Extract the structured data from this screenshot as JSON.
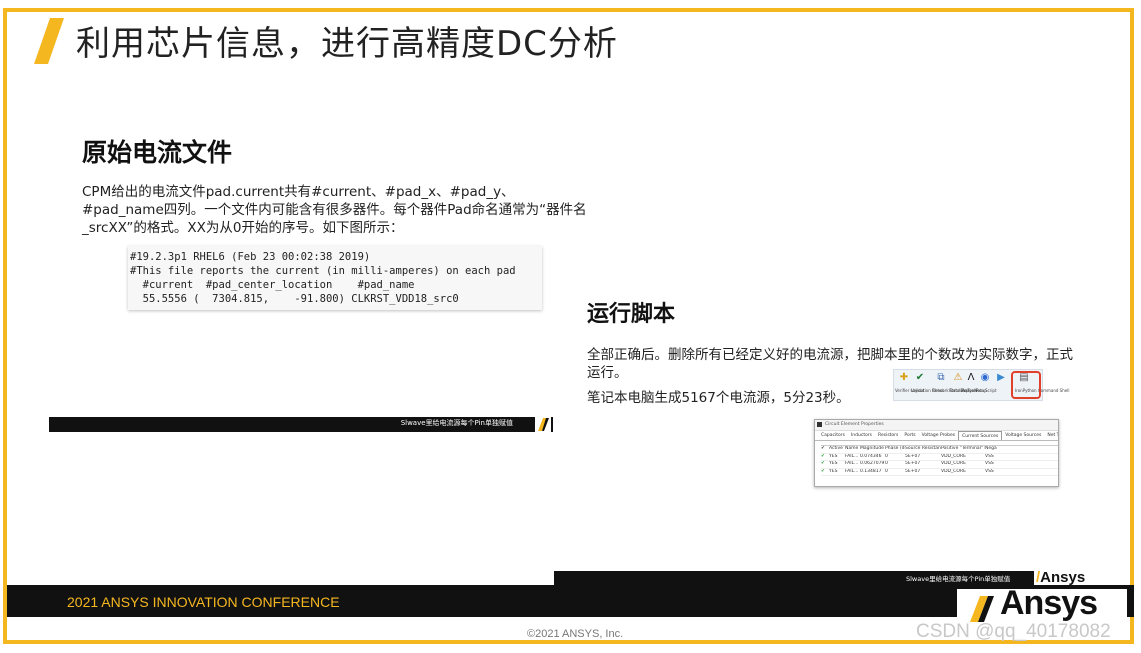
{
  "slide": {
    "title": "利用芯片信息，进行高精度DC分析",
    "accent_color": "#f5b720"
  },
  "left": {
    "heading": "原始电流文件",
    "description": "CPM给出的电流文件pad.current共有#current、#pad_x、#pad_y、#pad_name四列。一个文件内可能含有很多器件。每个器件Pad命名通常为“器件名_srcXX”的格式。XX为从0开始的序号。如下图所示：",
    "code_lines": [
      "#19.2.3p1 RHEL6 (Feb 23 00:02:38 2019)",
      "#This file reports the current (in milli-amperes) on each pad",
      "  #current  #pad_center_location    #pad_name",
      "  55.5556 (  7304.815,    -91.800) CLKRST_VDD18_src0"
    ],
    "band_text": "Slwave里给电流源每个Pin单独赋值"
  },
  "right": {
    "heading": "运行脚本",
    "paragraph1": "全部正确后。删除所有已经定义好的电流源，把脚本里的个数改为实际数字，正式运行。",
    "paragraph2": "笔记本电脑生成5167个电流源，5分23秒。",
    "toolbar": [
      {
        "icon": "plus-icon",
        "glyph": "✚",
        "label": "Verifier Layout"
      },
      {
        "icon": "check-icon",
        "glyph": "✔",
        "label": "Validation Check"
      },
      {
        "icon": "network-icon",
        "glyph": "⧉",
        "label": "Network Data Explorer"
      },
      {
        "icon": "warning-icon",
        "glyph": "⚠",
        "label": "PortsWiz Tools"
      },
      {
        "icon": "ansys-icon",
        "glyph": "Λ",
        "label": "Ansys Setup"
      },
      {
        "icon": "globe-icon",
        "glyph": "◉",
        "label": "Run Script"
      },
      {
        "icon": "run-icon",
        "glyph": "▶",
        "label": ""
      },
      {
        "icon": "script-icon",
        "glyph": "▤",
        "label": "IronPython Command Shell"
      }
    ],
    "dialog": {
      "title": "Circuit Element Properties",
      "tabs": [
        "Capacitors",
        "Inductors",
        "Resistors",
        "Ports",
        "Voltage Probes",
        "Current Sources",
        "Voltage Sources",
        "Net Terminals"
      ],
      "active_tab": "Current Sources",
      "columns": [
        "Active",
        "Name",
        "Magnitude (A)",
        "Phase (deg)",
        "Source Resistance (oh...",
        "Positive \"Terminal\" Net",
        "Nega"
      ],
      "rows": [
        [
          "YES",
          "FAIL...",
          "0.074346",
          "0",
          "5E+07",
          "VDD_CORE",
          "VSS"
        ],
        [
          "YES",
          "FAIL...",
          "0.0627079",
          "0",
          "5E+07",
          "VDD_CORE",
          "VSS"
        ],
        [
          "YES",
          "FAIL...",
          "0.134817",
          "0",
          "5E+07",
          "VDD_CORE",
          "VSS"
        ]
      ]
    },
    "band_text": "Slwave里给电流源每个Pin单独赋值"
  },
  "footer": {
    "conference": "2021 ANSYS INNOVATION CONFERENCE",
    "logo_small": "Ansys",
    "logo_big": "Ansys",
    "copyright": "©2021 ANSYS, Inc.",
    "watermark": "CSDN @qq_40178082"
  }
}
